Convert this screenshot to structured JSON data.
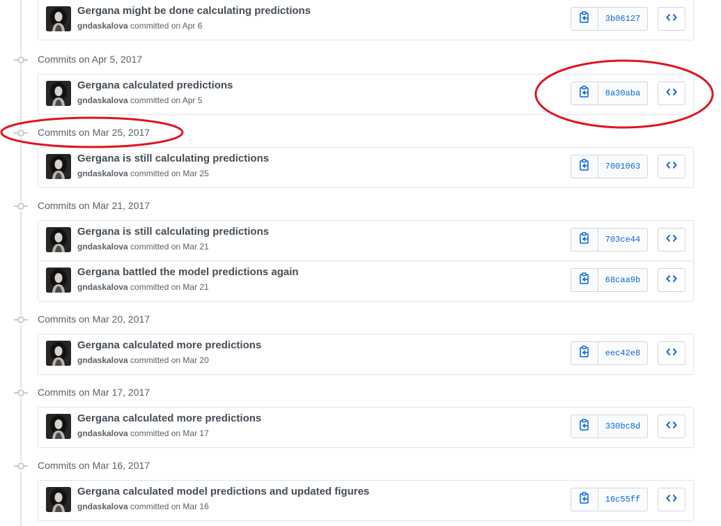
{
  "commit_groups": [
    {
      "date_label": "",
      "commits": [
        {
          "title": "Gergana might be done calculating predictions",
          "author": "gndaskalova",
          "committed_text": "committed on Apr 6",
          "sha": "3b06127"
        }
      ]
    },
    {
      "date_label": "Commits on Apr 5, 2017",
      "commits": [
        {
          "title": "Gergana calculated predictions",
          "author": "gndaskalova",
          "committed_text": "committed on Apr 5",
          "sha": "8a30aba"
        }
      ]
    },
    {
      "date_label": "Commits on Mar 25, 2017",
      "commits": [
        {
          "title": "Gergana is still calculating predictions",
          "author": "gndaskalova",
          "committed_text": "committed on Mar 25",
          "sha": "7001063"
        }
      ]
    },
    {
      "date_label": "Commits on Mar 21, 2017",
      "commits": [
        {
          "title": "Gergana is still calculating predictions",
          "author": "gndaskalova",
          "committed_text": "committed on Mar 21",
          "sha": "703ce44"
        },
        {
          "title": "Gergana battled the model predictions again",
          "author": "gndaskalova",
          "committed_text": "committed on Mar 21",
          "sha": "68caa9b"
        }
      ]
    },
    {
      "date_label": "Commits on Mar 20, 2017",
      "commits": [
        {
          "title": "Gergana calculated more predictions",
          "author": "gndaskalova",
          "committed_text": "committed on Mar 20",
          "sha": "eec42e8"
        }
      ]
    },
    {
      "date_label": "Commits on Mar 17, 2017",
      "commits": [
        {
          "title": "Gergana calculated more predictions",
          "author": "gndaskalova",
          "committed_text": "committed on Mar 17",
          "sha": "330bc8d"
        }
      ]
    },
    {
      "date_label": "Commits on Mar 16, 2017",
      "commits": [
        {
          "title": "Gergana calculated model predictions and updated figures",
          "author": "gndaskalova",
          "committed_text": "committed on Mar 16",
          "sha": "16c55ff"
        }
      ]
    }
  ],
  "icons": {
    "copy": "clippy-icon",
    "browse": "code-icon",
    "timeline_marker": "git-commit-icon"
  },
  "colors": {
    "sha_link": "#0366d6",
    "annotation": "#e0141e",
    "border": "#e1e4e8"
  }
}
